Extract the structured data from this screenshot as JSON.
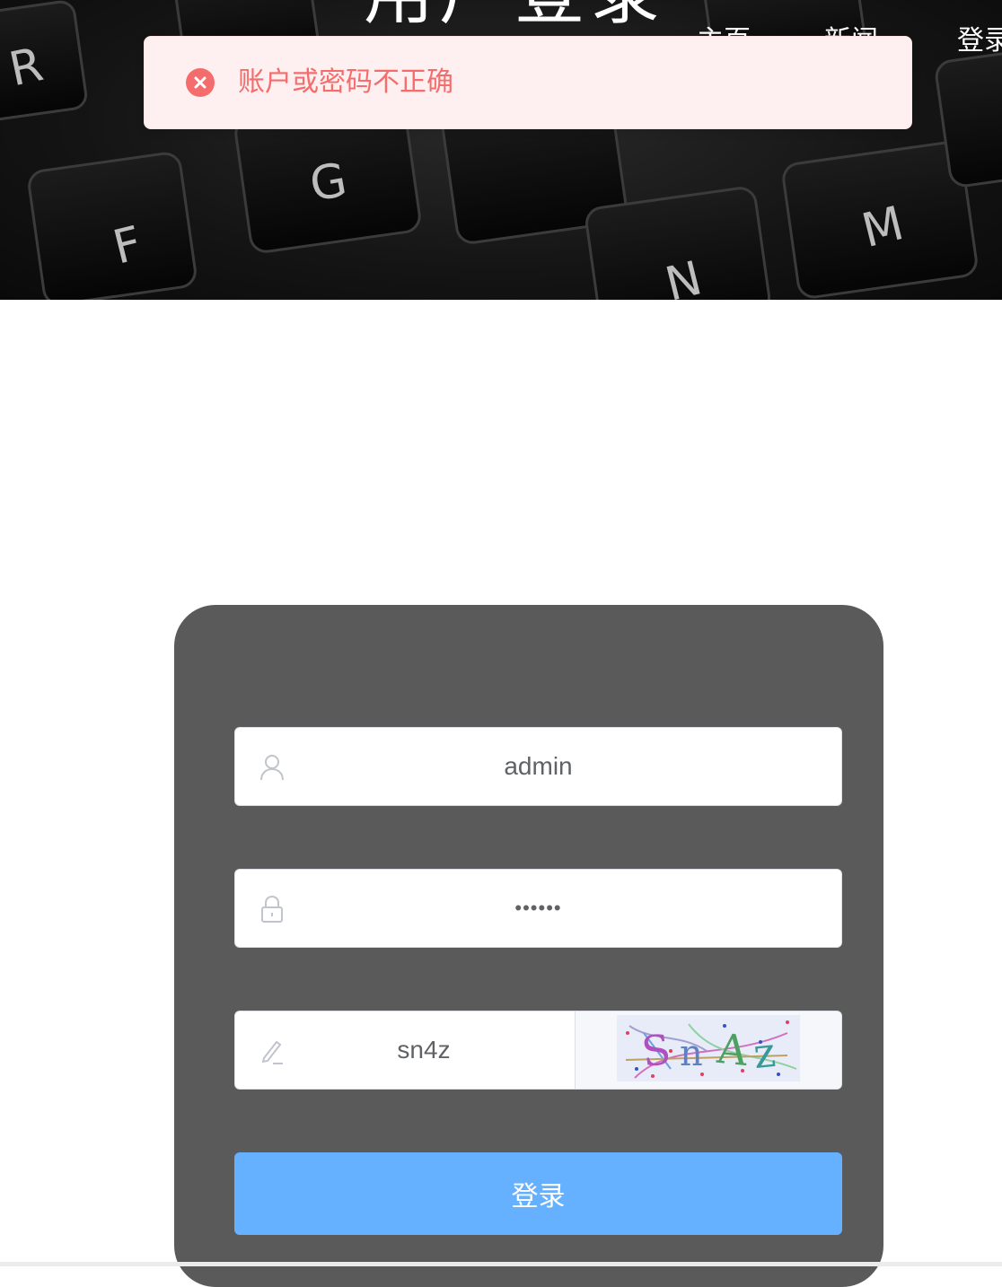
{
  "header": {
    "title": "用户登录",
    "nav": {
      "home": "主页",
      "news": "新闻",
      "login": "登录"
    }
  },
  "toast": {
    "type": "error",
    "icon": "error-circle-icon",
    "message": "账户或密码不正确",
    "color": "#f56c6c"
  },
  "hero_keys": [
    "R",
    "F",
    "G",
    "N",
    "M"
  ],
  "form": {
    "username": {
      "icon": "user-icon",
      "value": "admin"
    },
    "password": {
      "icon": "lock-icon",
      "value": "••••••"
    },
    "captcha": {
      "icon": "pencil-icon",
      "value": "sn4z",
      "image_text": "SnAz"
    },
    "submit_label": "登录",
    "submit_color": "#66b1ff"
  }
}
